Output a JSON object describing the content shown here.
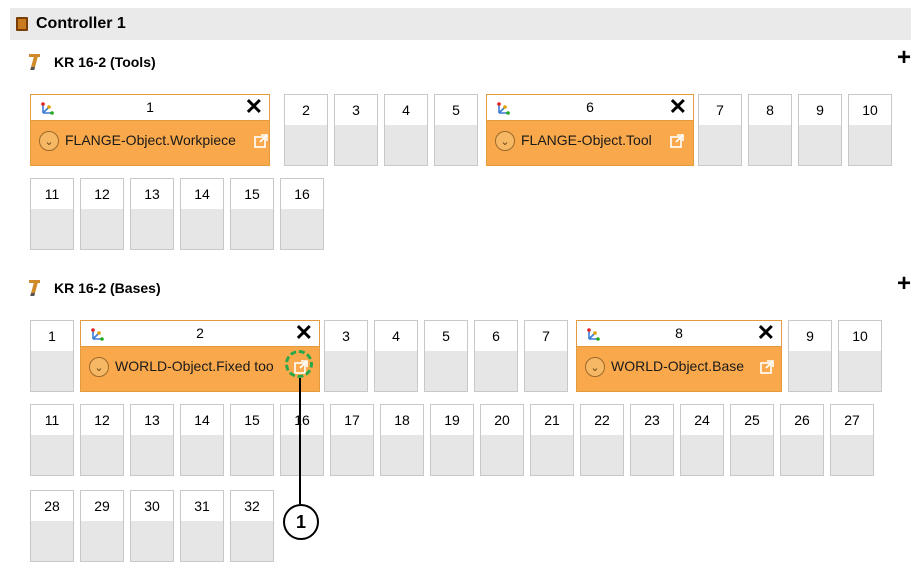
{
  "controller": {
    "title": "Controller 1"
  },
  "tools": {
    "title": "KR 16-2 (Tools)",
    "big": [
      {
        "num": "1",
        "label": "FLANGE-Object.Workpiece"
      },
      {
        "num": "6",
        "label": "FLANGE-Object.Tool"
      }
    ],
    "slots": [
      "2",
      "3",
      "4",
      "5",
      "7",
      "8",
      "9",
      "10",
      "11",
      "12",
      "13",
      "14",
      "15",
      "16"
    ]
  },
  "bases": {
    "title": "KR 16-2 (Bases)",
    "big": [
      {
        "num": "2",
        "label": "WORLD-Object.Fixed too"
      },
      {
        "num": "8",
        "label": "WORLD-Object.Base"
      }
    ],
    "slots": [
      "1",
      "3",
      "4",
      "5",
      "6",
      "7",
      "9",
      "10",
      "11",
      "12",
      "13",
      "14",
      "15",
      "16",
      "17",
      "18",
      "19",
      "20",
      "21",
      "22",
      "23",
      "24",
      "25",
      "26",
      "27",
      "28",
      "29",
      "30",
      "31",
      "32"
    ]
  },
  "callout": {
    "label": "1"
  },
  "icons": {
    "plus": "+",
    "close": "✕",
    "chevron": "⌄"
  },
  "colors": {
    "accent": "#f9a94b",
    "highlight": "#2aa84a"
  }
}
